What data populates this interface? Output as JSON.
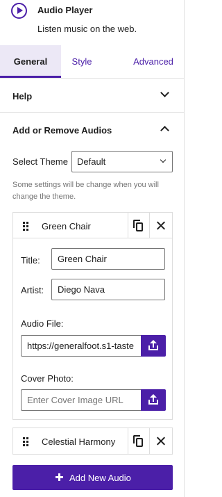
{
  "header": {
    "title": "Audio Player",
    "subtitle": "Listen music on the web."
  },
  "tabs": [
    {
      "label": "General",
      "active": true
    },
    {
      "label": "Style",
      "active": false
    },
    {
      "label": "Advanced",
      "active": false
    }
  ],
  "sections": {
    "help": {
      "label": "Help",
      "expanded": false
    },
    "add_remove": {
      "label": "Add or Remove Audios",
      "expanded": true
    }
  },
  "theme": {
    "label": "Select Theme",
    "value": "Default",
    "note": "Some settings will be change when you will change the theme."
  },
  "audios": [
    {
      "name": "Green Chair",
      "expanded": true,
      "title_label": "Title:",
      "title_value": "Green Chair",
      "artist_label": "Artist:",
      "artist_value": "Diego Nava",
      "file_label": "Audio File:",
      "file_value": "https://generalfoot.s1-taste",
      "cover_label": "Cover Photo:",
      "cover_placeholder": "Enter Cover Image URL"
    },
    {
      "name": "Celestial Harmony",
      "expanded": false
    }
  ],
  "add_button": {
    "label": "Add New Audio"
  },
  "colors": {
    "accent": "#4b1fa8",
    "active_tab_bg": "#ece8f6",
    "border": "#dddddd"
  }
}
